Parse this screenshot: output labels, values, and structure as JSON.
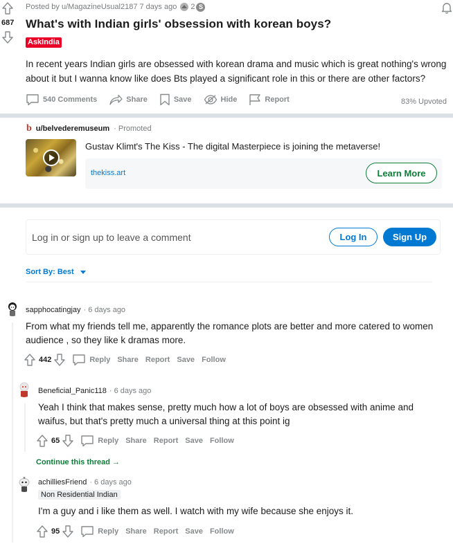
{
  "post": {
    "score": "687",
    "meta": "Posted by u/MagazineUsual2187 7 days ago",
    "award_count": "2",
    "award_coin": "S",
    "title": "What's with Indian girls' obsession with korean boys?",
    "flair": "AskIndia",
    "body": "In recent years Indian girls are obsessed with korean drama and music which is great nothing's wrong about it but I wanna know like does Bts played a significant role in this or there are other factors?",
    "actions": {
      "comments": "540 Comments",
      "share": "Share",
      "save": "Save",
      "hide": "Hide",
      "report": "Report"
    },
    "upvoted": "83% Upvoted"
  },
  "ad": {
    "logo": "b",
    "user": "u/belvederemuseum",
    "promoted": "· Promoted",
    "title": "Gustav Klimt's The Kiss - The digital Masterpiece is joining the metaverse!",
    "domain": "thekiss.art",
    "cta": "Learn More"
  },
  "login": {
    "prompt": "Log in or sign up to leave a comment",
    "login_label": "Log In",
    "signup_label": "Sign Up"
  },
  "sort": {
    "label": "Sort By: Best"
  },
  "comments": [
    {
      "author": "sapphocatingjay",
      "time": "· 6 days ago",
      "body": "From what my friends tell me, apparently the romance plots are better and more catered to women audience , so they like k dramas more.",
      "score": "442",
      "reply": "Reply",
      "share": "Share",
      "report": "Report",
      "save": "Save",
      "follow": "Follow"
    },
    {
      "author": "Beneficial_Panic118",
      "time": "· 6 days ago",
      "body": "Yeah I think that makes sense, pretty much how a lot of boys are obsessed with anime and waifus, but that's pretty much a universal thing at this point ig",
      "score": "65",
      "reply": "Reply",
      "share": "Share",
      "report": "Report",
      "save": "Save",
      "follow": "Follow"
    },
    {
      "author": "achilliesFriend",
      "time": "· 6 days ago",
      "flair": "Non Residential Indian",
      "body": "I'm a guy and i like them as well. I watch with my wife because she enjoys it.",
      "score": "95",
      "reply": "Reply",
      "share": "Share",
      "report": "Report",
      "save": "Save",
      "follow": "Follow"
    }
  ],
  "continue_thread": "Continue this thread",
  "colors": {
    "accent": "#0079d3",
    "flair_red": "#ea0027",
    "green": "#0e7d39",
    "muted": "#878a8c",
    "band": "#dae0e6"
  }
}
